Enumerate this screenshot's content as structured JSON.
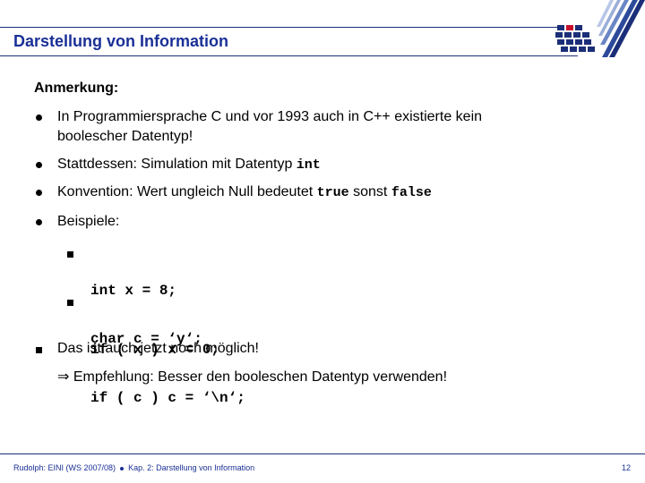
{
  "header": {
    "title": "Darstellung von Information",
    "logo_icon": "university-logo-icon"
  },
  "content": {
    "heading": "Anmerkung:",
    "bullets": [
      {
        "text_lines": [
          "In Programmiersprache C und vor 1993 auch in C++ existierte kein",
          "boolescher Datentyp!"
        ]
      },
      {
        "prefix": "Stattdessen: Simulation mit Datentyp ",
        "code": "int"
      },
      {
        "prefix": "Konvention: Wert ungleich Null bedeutet ",
        "code1": "true",
        "middle": " sonst ",
        "code2": "false"
      },
      {
        "text": "Beispiele:"
      }
    ],
    "examples": [
      {
        "lines": [
          "int x = 8;",
          "if ( x ) x = 0;"
        ]
      },
      {
        "lines": [
          "char c = ‘y‘;",
          "if ( c ) c = ‘\\n‘;"
        ]
      }
    ],
    "note": "Das ist auch jetzt noch möglich!",
    "recommendation_arrow": "⇒",
    "recommendation": "Empfehlung: Besser den booleschen Datentyp verwenden!"
  },
  "footer": {
    "left": "Rudolph: EINI (WS 2007/08)",
    "right": "Kap. 2: Darstellung von Information",
    "page": "12"
  },
  "colors": {
    "brand": "#1a2f96",
    "logo_red": "#c8102e"
  }
}
